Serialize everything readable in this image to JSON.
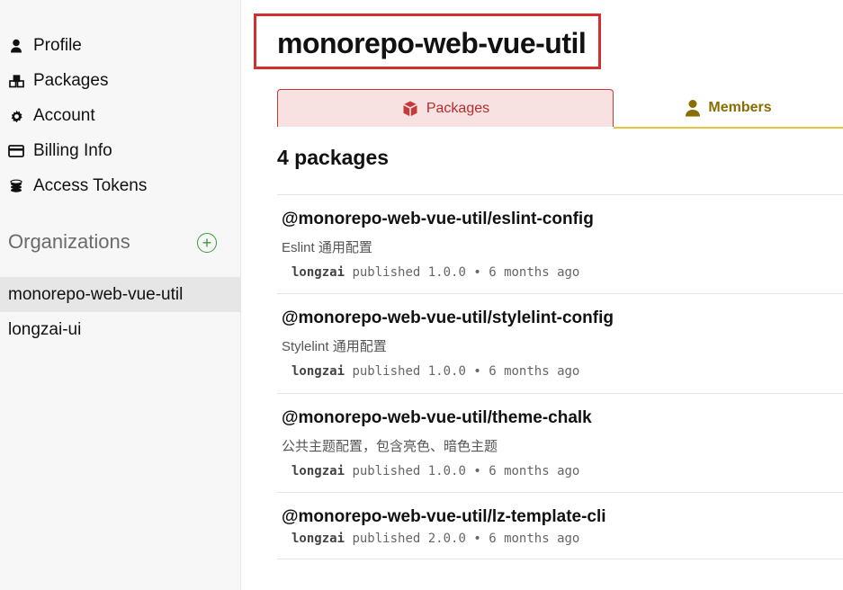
{
  "sidebar": {
    "nav": [
      {
        "label": "Profile",
        "icon": "user-icon"
      },
      {
        "label": "Packages",
        "icon": "packages-icon"
      },
      {
        "label": "Account",
        "icon": "gear-icon"
      },
      {
        "label": "Billing Info",
        "icon": "credit-card-icon"
      },
      {
        "label": "Access Tokens",
        "icon": "tokens-icon"
      }
    ],
    "organizations_heading": "Organizations",
    "organizations": [
      {
        "label": "monorepo-web-vue-util",
        "active": true
      },
      {
        "label": "longzai-ui",
        "active": false
      }
    ]
  },
  "main": {
    "title": "monorepo-web-vue-util",
    "tabs": {
      "packages": "Packages",
      "members": "Members"
    },
    "count_label": "4 packages",
    "packages": [
      {
        "name": "@monorepo-web-vue-util/eslint-config",
        "description": "Eslint 通用配置",
        "publisher": "longzai",
        "published_word": "published",
        "version": "1.0.0",
        "sep": "•",
        "age": "6 months ago"
      },
      {
        "name": "@monorepo-web-vue-util/stylelint-config",
        "description": "Stylelint 通用配置",
        "publisher": "longzai",
        "published_word": "published",
        "version": "1.0.0",
        "sep": "•",
        "age": "6 months ago"
      },
      {
        "name": "@monorepo-web-vue-util/theme-chalk",
        "description": "公共主题配置，包含亮色、暗色主题",
        "publisher": "longzai",
        "published_word": "published",
        "version": "1.0.0",
        "sep": "•",
        "age": "6 months ago"
      },
      {
        "name": "@monorepo-web-vue-util/lz-template-cli",
        "description": "",
        "publisher": "longzai",
        "published_word": "published",
        "version": "2.0.0",
        "sep": "•",
        "age": "6 months ago"
      }
    ]
  },
  "colors": {
    "highlight_border": "#d32f2f",
    "packages_tab_bg": "#f8e1e1",
    "packages_tab_text": "#b22d2d",
    "members_tab_text": "#8a6d00",
    "members_underline": "#e8c23c",
    "add_org_green": "#3a9a3a"
  }
}
